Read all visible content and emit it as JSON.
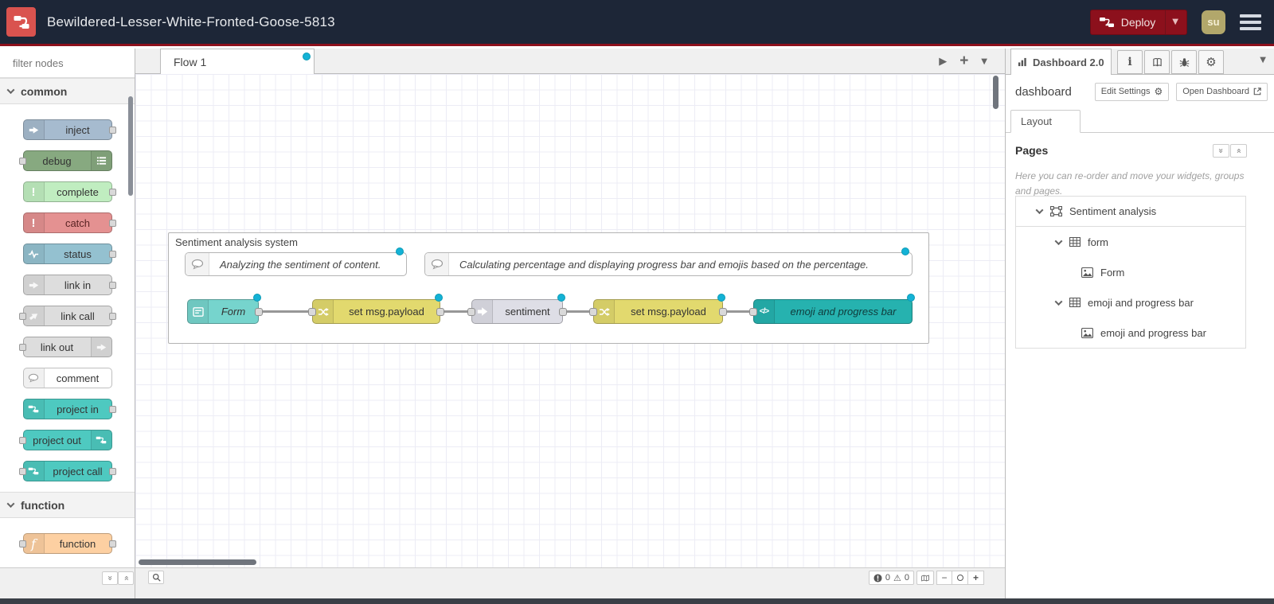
{
  "colors": {
    "header_bg": "#1d2637",
    "accent_red": "#8C101C",
    "logo_red": "#d9534f",
    "changed_dot": "#14b2d6",
    "avatar_bg": "#b2a76b"
  },
  "header": {
    "title": "Bewildered-Lesser-White-Fronted-Goose-5813",
    "deploy_label": "Deploy",
    "user_initials": "su"
  },
  "palette": {
    "filter_placeholder": "filter nodes",
    "categories": [
      {
        "label": "common",
        "nodes": [
          {
            "label": "inject",
            "color": "#a6bbcf"
          },
          {
            "label": "debug",
            "color": "#87a980"
          },
          {
            "label": "complete",
            "color": "#c0edc0"
          },
          {
            "label": "catch",
            "color": "#e49191"
          },
          {
            "label": "status",
            "color": "#94c1d0"
          },
          {
            "label": "link in",
            "color": "#dddddd"
          },
          {
            "label": "link call",
            "color": "#dddddd"
          },
          {
            "label": "link out",
            "color": "#dddddd"
          },
          {
            "label": "comment",
            "color": "#ffffff"
          },
          {
            "label": "project in",
            "color": "#4ec9c0"
          },
          {
            "label": "project out",
            "color": "#4ec9c0"
          },
          {
            "label": "project call",
            "color": "#4ec9c0"
          }
        ]
      },
      {
        "label": "function",
        "nodes": [
          {
            "label": "function",
            "color": "#fdd0a2"
          }
        ]
      }
    ]
  },
  "workspace": {
    "tab_label": "Flow 1",
    "group_label": "Sentiment analysis system",
    "comments": [
      {
        "text": "Analyzing the sentiment of content."
      },
      {
        "text": "Calculating percentage and displaying progress bar and emojis based on the percentage."
      }
    ],
    "nodes": [
      {
        "label": "Form",
        "color": "#76d4cd"
      },
      {
        "label": "set msg.payload",
        "color": "#e2d96e"
      },
      {
        "label": "sentiment",
        "color": "#dedee6"
      },
      {
        "label": "set msg.payload",
        "color": "#e2d96e"
      },
      {
        "label": "emoji and progress bar",
        "color": "#26b2af"
      }
    ],
    "footer": {
      "error_count": "0",
      "warning_count": "0"
    }
  },
  "sidebar": {
    "tab_label": "Dashboard 2.0",
    "section_title": "dashboard",
    "edit_settings_label": "Edit Settings",
    "open_dashboard_label": "Open Dashboard",
    "layout_tab_label": "Layout",
    "pages_heading": "Pages",
    "description": "Here you can re-order and move your widgets, groups and pages.",
    "tree": [
      {
        "label": "Sentiment analysis",
        "type": "page"
      },
      {
        "label": "form",
        "type": "group"
      },
      {
        "label": "Form",
        "type": "widget"
      },
      {
        "label": "emoji and progress bar",
        "type": "group"
      },
      {
        "label": "emoji and progress bar",
        "type": "widget"
      }
    ]
  }
}
